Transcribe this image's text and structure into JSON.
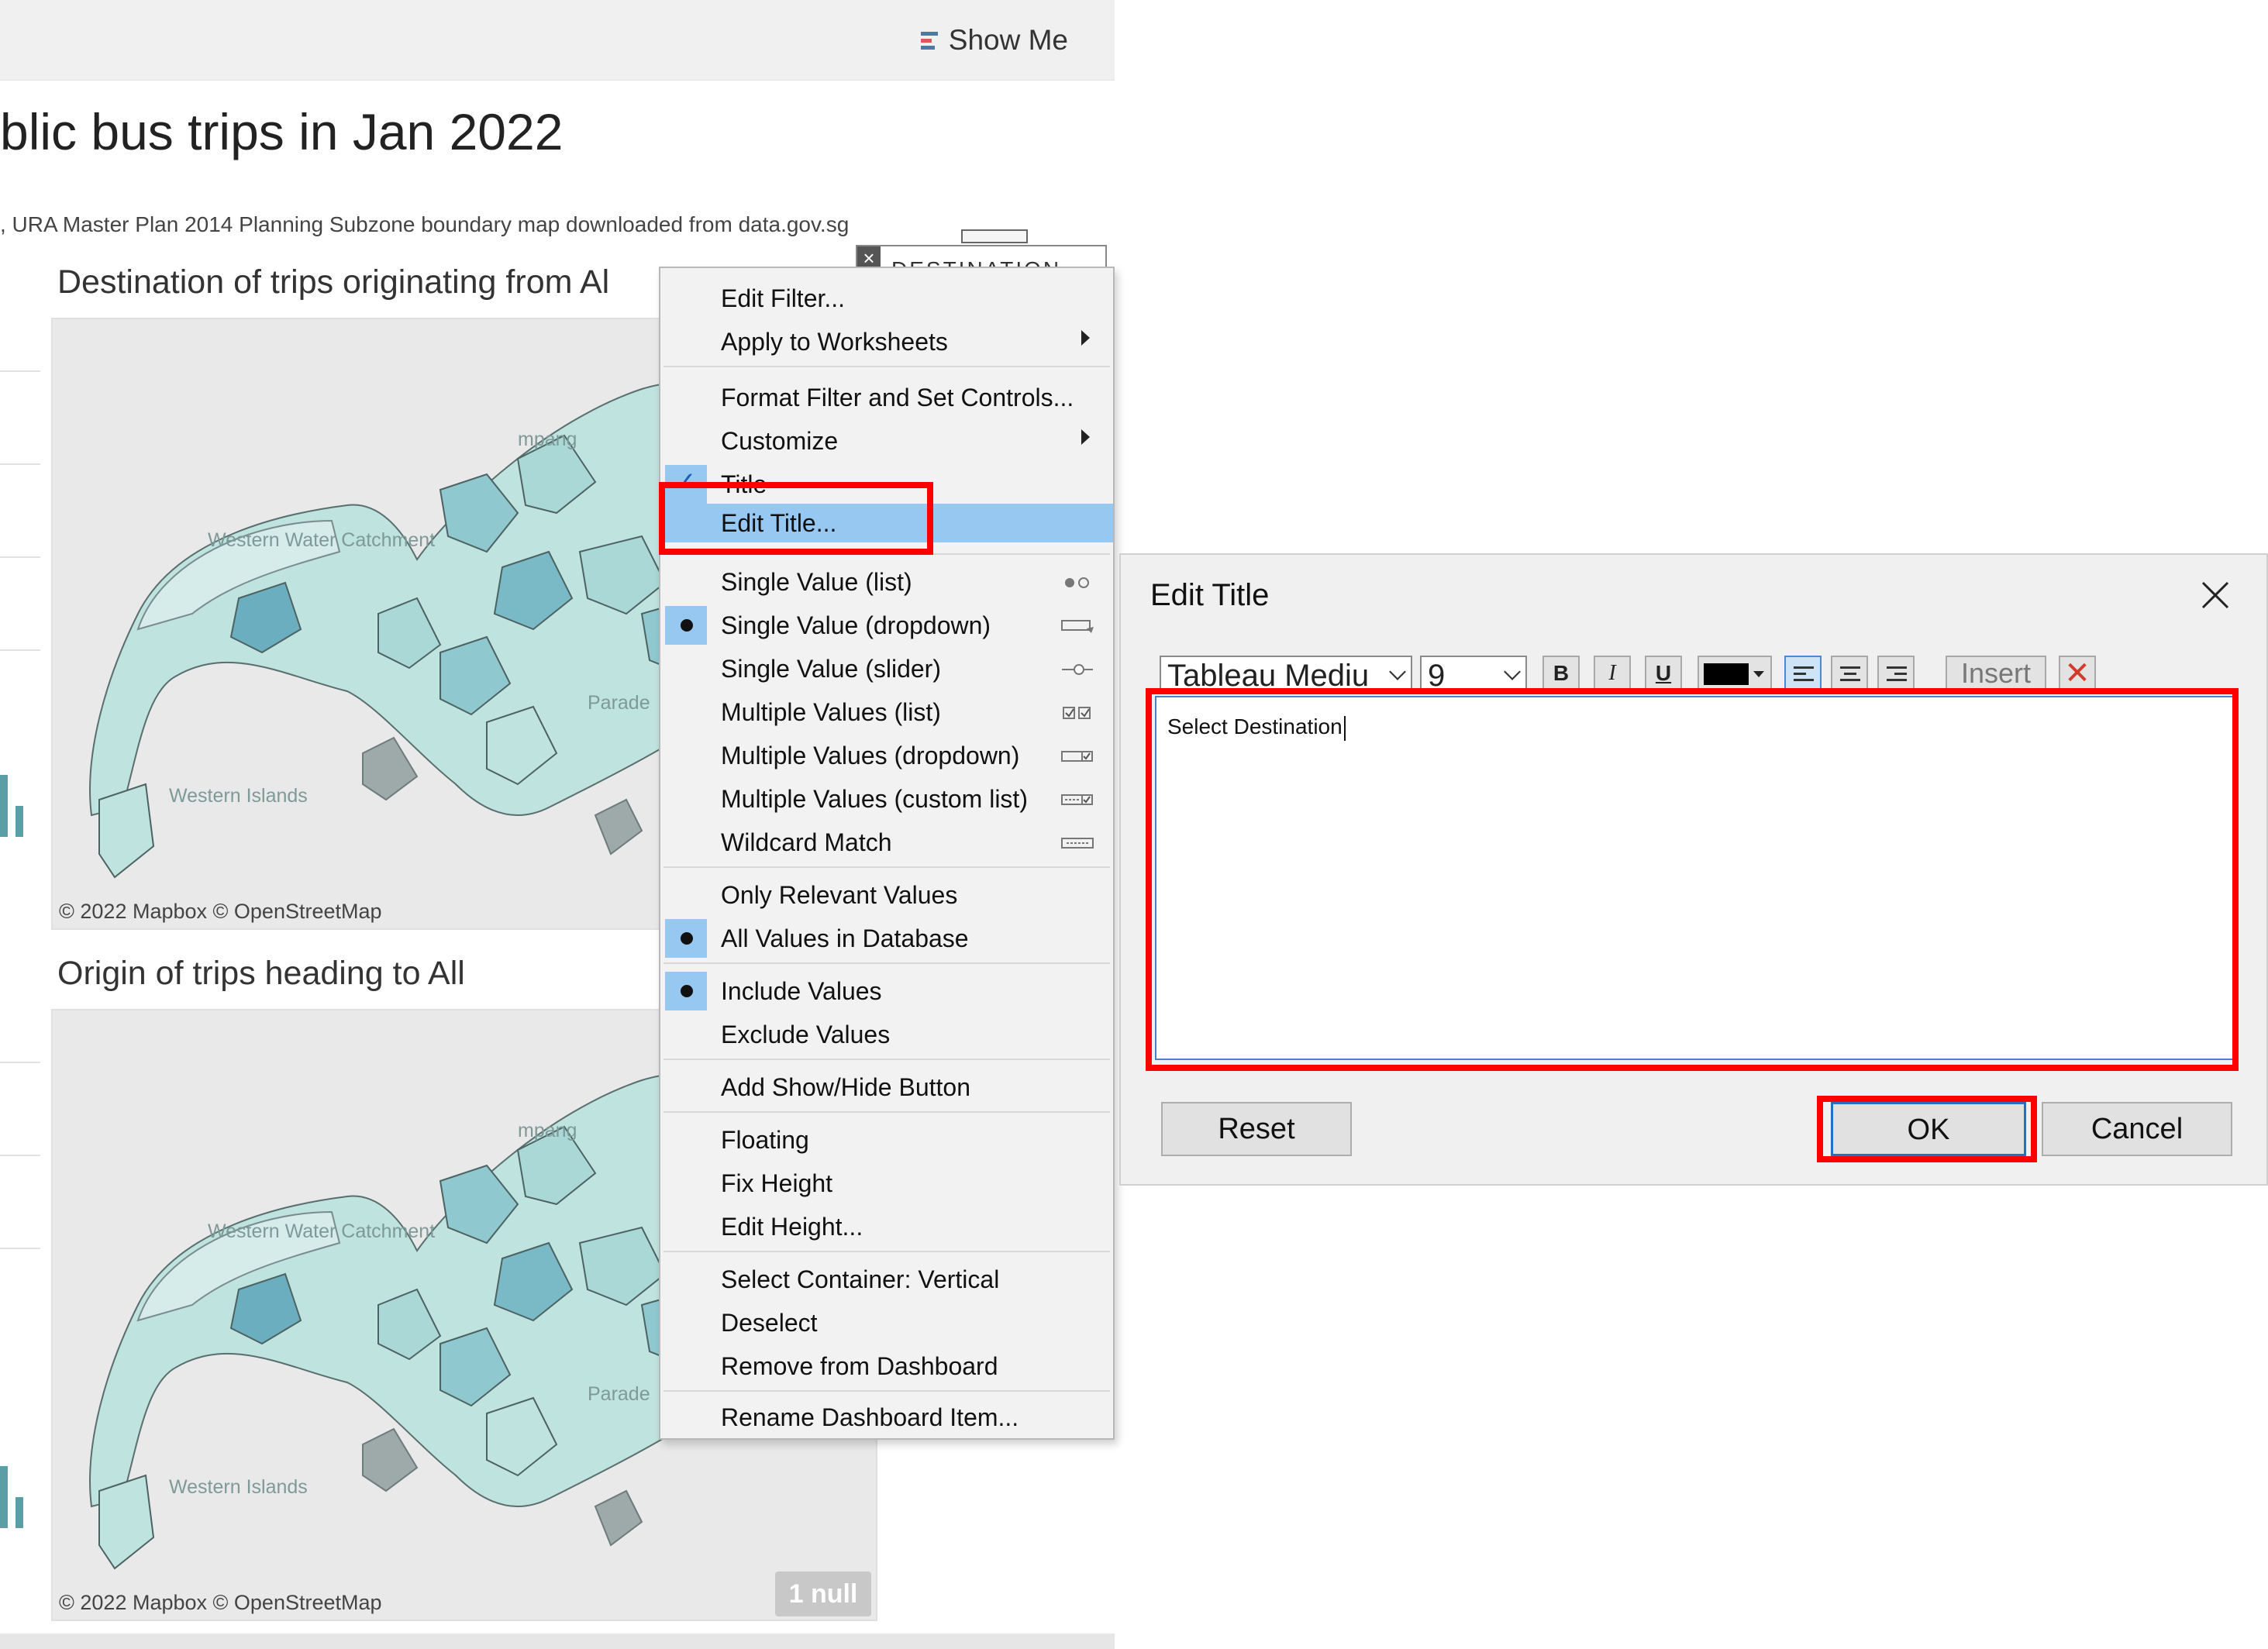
{
  "toolbar": {
    "show_me_label": "Show Me",
    "show_me_icon": "show-me-chart-icon"
  },
  "dashboard": {
    "title": "blic bus trips in Jan 2022",
    "source": ", URA Master Plan 2014 Planning Subzone boundary map downloaded from data.gov.sg",
    "section1_title": "Destination of trips originating from Al",
    "section2_title": "Origin of trips heading to All",
    "map_credit": "© 2022 Mapbox © OpenStreetMap",
    "map_labels": {
      "western_water_catchment": "Western Water Catchment",
      "western_islands": "Western Islands",
      "parade": "Parade",
      "mpang": "mpang"
    },
    "filter_label": "DESTINATION",
    "null_badge": "1 null",
    "map_fill_color": "#bfe3df",
    "map_dark_color": "#6aaec0",
    "annotation_color": "#ff0000"
  },
  "context_menu": {
    "groups": [
      [
        {
          "label": "Edit Filter...",
          "submenu": false
        },
        {
          "label": "Apply to Worksheets",
          "submenu": true
        }
      ],
      [
        {
          "label": "Format Filter and Set Controls...",
          "submenu": false
        },
        {
          "label": "Customize",
          "submenu": true
        },
        {
          "label": "Title",
          "checked": true
        },
        {
          "label": "Edit Title...",
          "highlighted": true
        }
      ],
      [
        {
          "label": "Single Value (list)",
          "icon": "radio-list-icon"
        },
        {
          "label": "Single Value (dropdown)",
          "icon": "dropdown-icon",
          "selected": true
        },
        {
          "label": "Single Value (slider)",
          "icon": "slider-icon"
        },
        {
          "label": "Multiple Values (list)",
          "icon": "checkbox-list-icon"
        },
        {
          "label": "Multiple Values (dropdown)",
          "icon": "checkbox-dropdown-icon"
        },
        {
          "label": "Multiple Values (custom list)",
          "icon": "custom-list-icon"
        },
        {
          "label": "Wildcard Match",
          "icon": "wildcard-icon"
        }
      ],
      [
        {
          "label": "Only Relevant Values"
        },
        {
          "label": "All Values in Database",
          "selected": true
        }
      ],
      [
        {
          "label": "Include Values",
          "selected": true
        },
        {
          "label": "Exclude Values"
        }
      ],
      [
        {
          "label": "Add Show/Hide Button"
        }
      ],
      [
        {
          "label": "Floating"
        },
        {
          "label": "Fix Height"
        },
        {
          "label": "Edit Height..."
        }
      ],
      [
        {
          "label": "Select Container: Vertical"
        },
        {
          "label": "Deselect"
        },
        {
          "label": "Remove from Dashboard"
        }
      ],
      [
        {
          "label": "Rename Dashboard Item..."
        }
      ]
    ]
  },
  "dialog": {
    "title": "Edit Title",
    "font_name": "Tableau Mediu",
    "font_size": "9",
    "bold": "B",
    "italic": "I",
    "underline": "U",
    "insert_label": "Insert",
    "text_value": "Select Destination",
    "text_color": "#000000",
    "reset_label": "Reset",
    "ok_label": "OK",
    "cancel_label": "Cancel"
  }
}
